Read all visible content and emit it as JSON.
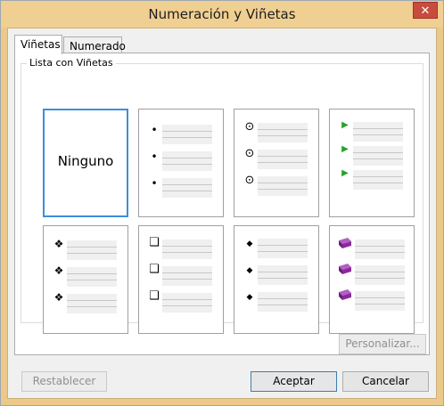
{
  "window": {
    "title": "Numeración y Viñetas",
    "close_glyph": "✕"
  },
  "tabs": [
    {
      "label": "Viñetas"
    },
    {
      "label": "Numerado"
    }
  ],
  "group": {
    "label": "Lista con Viñetas"
  },
  "gallery": {
    "selected_index": 0,
    "cells": [
      {
        "label": "Ninguno",
        "bullet": null
      },
      {
        "label": "",
        "bullet": "•"
      },
      {
        "label": "",
        "bullet": "⊙"
      },
      {
        "label": "",
        "bullet": "▶"
      },
      {
        "label": "",
        "bullet": "❖"
      },
      {
        "label": "",
        "bullet": "❑"
      },
      {
        "label": "",
        "bullet": "◆"
      },
      {
        "label": "",
        "bullet": "book-icon"
      }
    ],
    "colors": {
      "arrow": "#28a228",
      "book": "#8b2a9c"
    }
  },
  "buttons": {
    "personalizar": "Personalizar...",
    "restablecer": "Restablecer",
    "aceptar": "Aceptar",
    "cancelar": "Cancelar"
  }
}
